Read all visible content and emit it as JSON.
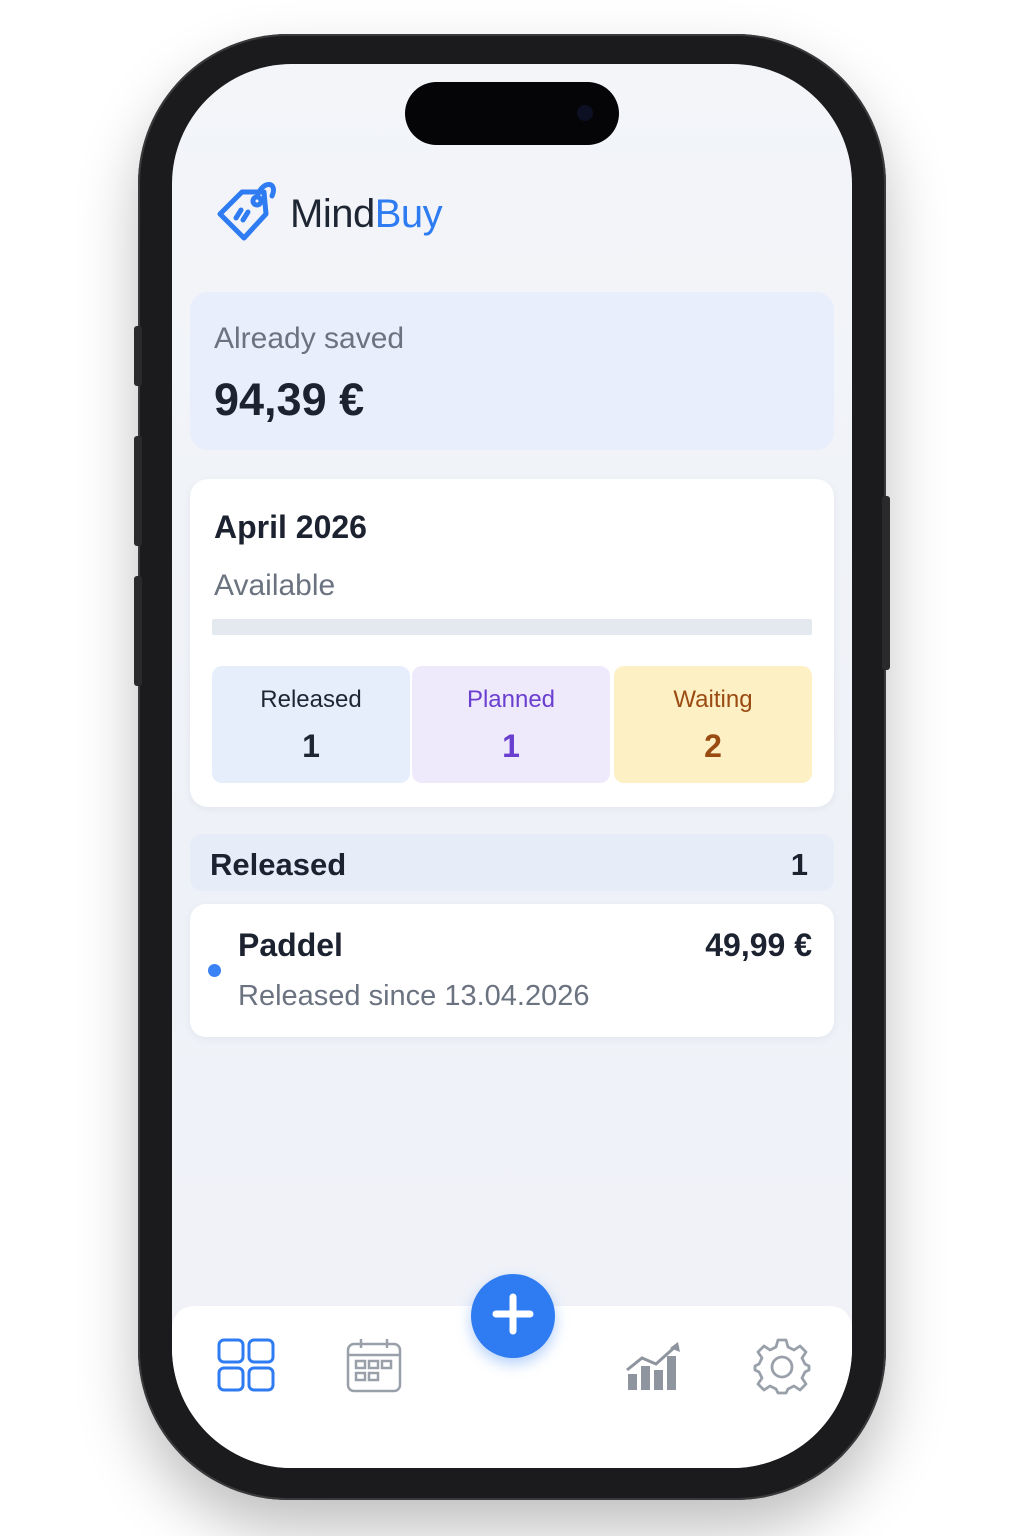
{
  "app": {
    "name_part1": "Mind",
    "name_part2": "Buy"
  },
  "savings": {
    "label": "Already saved",
    "amount": "94,39 €"
  },
  "month": {
    "title": "April 2026",
    "available_label": "Available",
    "available_fraction": 0.0,
    "stats": [
      {
        "label": "Released",
        "value": "1"
      },
      {
        "label": "Planned",
        "value": "1"
      },
      {
        "label": "Waiting",
        "value": "2"
      }
    ]
  },
  "released_section": {
    "title": "Released",
    "count": "1",
    "items": [
      {
        "name": "Paddel",
        "price": "49,99 €",
        "subtitle": "Released since 13.04.2026"
      }
    ]
  },
  "tabbar": {
    "items": [
      {
        "icon": "dashboard-grid-icon",
        "active": true
      },
      {
        "icon": "calendar-icon",
        "active": false
      },
      {
        "icon": "add-plus-icon",
        "active": false
      },
      {
        "icon": "statistics-chart-icon",
        "active": false
      },
      {
        "icon": "settings-gear-icon",
        "active": false
      }
    ]
  },
  "colors": {
    "accent": "#2f7cf2",
    "released_bg": "#e6eefc",
    "planned_bg": "#efe9fc",
    "waiting_bg": "#fdf0c4",
    "inactive_icon": "#9aa0aa"
  }
}
